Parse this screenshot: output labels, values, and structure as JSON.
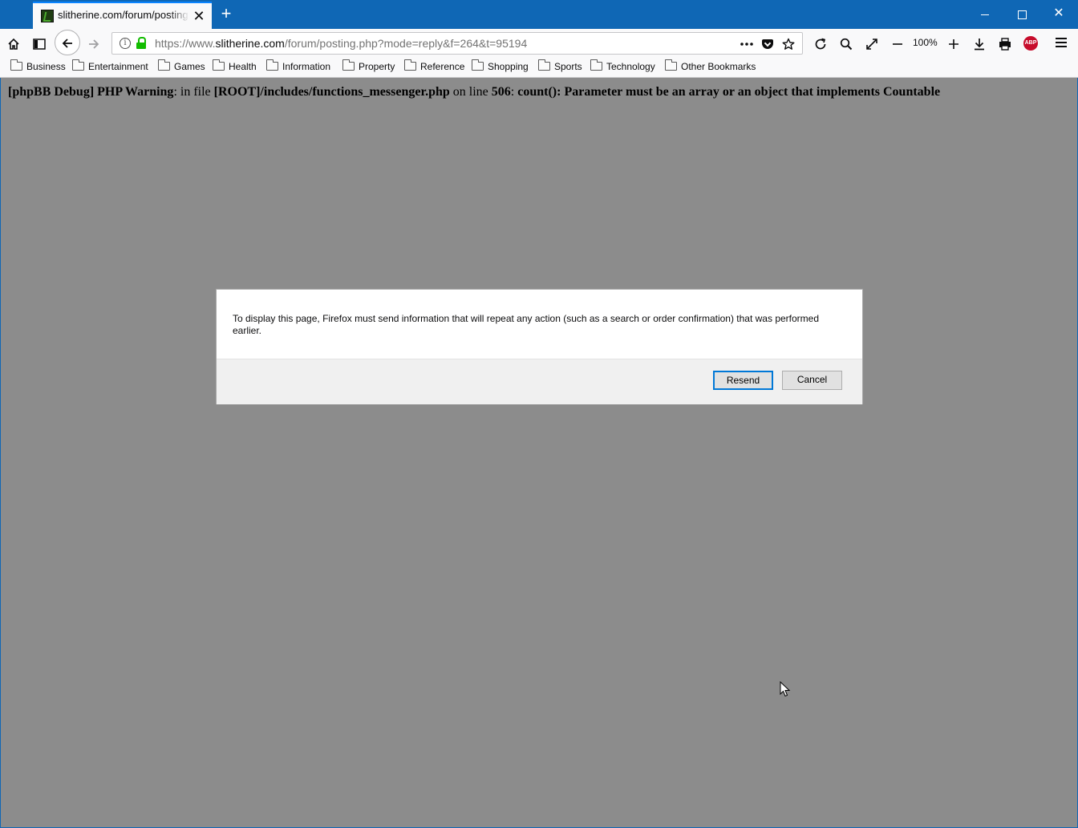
{
  "browser": {
    "tab": {
      "title": "slitherine.com/forum/posting.php",
      "close_label": "✕"
    },
    "new_tab_label": "+",
    "window_controls": {
      "close": "✕"
    },
    "url": {
      "prefix": "https://www.",
      "domain": "slitherine.com",
      "path": "/forum/posting.php?mode=reply&f=264&t=95194"
    },
    "zoom_level": "100%",
    "adblock_label": "ABP",
    "bookmarks": [
      "Business",
      "Entertainment",
      "Games",
      "Health",
      "Information",
      "Property",
      "Reference",
      "Shopping",
      "Sports",
      "Technology",
      "Other Bookmarks"
    ]
  },
  "page": {
    "warning": {
      "tag": "[phpBB Debug] PHP Warning",
      "in_file": ": in file ",
      "file": "[ROOT]/includes/functions_messenger.php",
      "on_line": " on line ",
      "line": "506",
      "sep": ": ",
      "message": "count(): Parameter must be an array or an object that implements Countable"
    }
  },
  "dialog": {
    "message": "To display this page, Firefox must send information that will repeat any action (such as a search or order confirmation) that was performed earlier.",
    "resend_label": "Resend",
    "cancel_label": "Cancel"
  },
  "colors": {
    "titlebar": "#0f67b5",
    "page_overlay": "#8c8c8c",
    "secure_lock": "#12bc00",
    "focus_border": "#0078d7",
    "abp_red": "#c70d2c"
  }
}
